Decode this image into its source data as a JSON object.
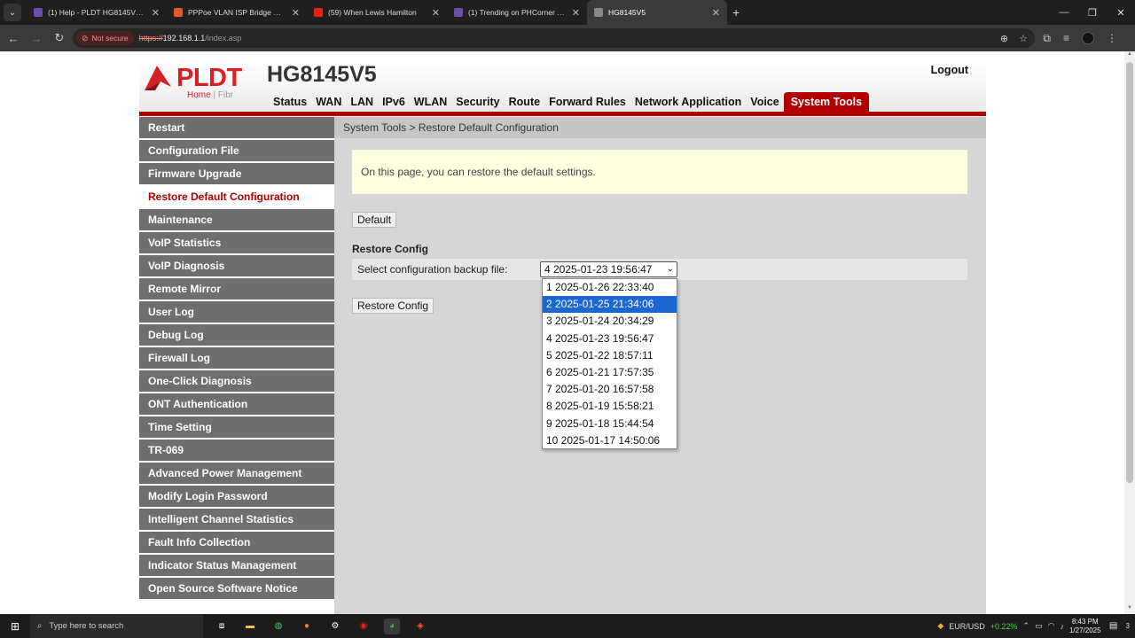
{
  "browser": {
    "tabs": [
      {
        "title": "(1) Help - PLDT HG8145V5 CGN",
        "color": "#6a4fa8",
        "active": false
      },
      {
        "title": "PPPoe VLAN ISP Bridge mode...",
        "color": "#e05a2b",
        "active": false
      },
      {
        "title": "(59) When Lewis Hamilton",
        "color": "#e62117",
        "active": false
      },
      {
        "title": "(1) Trending on PHCorner | Pin...",
        "color": "#6a4fa8",
        "active": false
      },
      {
        "title": "HG8145V5",
        "color": "#888888",
        "active": true
      }
    ],
    "security_chip": "Not secure",
    "url_scheme": "https://",
    "url_host": "192.168.1.1",
    "url_path": "/index.asp"
  },
  "router": {
    "logo": {
      "brand": "PLDT",
      "sub_home": "Home",
      "sub_fibr": "Fibr"
    },
    "model": "HG8145V5",
    "logout": "Logout",
    "nav": [
      "Status",
      "WAN",
      "LAN",
      "IPv6",
      "WLAN",
      "Security",
      "Route",
      "Forward Rules",
      "Network Application",
      "Voice",
      "System Tools"
    ],
    "nav_active": "System Tools",
    "sidebar": [
      "Restart",
      "Configuration File",
      "Firmware Upgrade",
      "Restore Default Configuration",
      "Maintenance",
      "VoIP Statistics",
      "VoIP Diagnosis",
      "Remote Mirror",
      "User Log",
      "Debug Log",
      "Firewall Log",
      "One-Click Diagnosis",
      "ONT Authentication",
      "Time Setting",
      "TR-069",
      "Advanced Power Management",
      "Modify Login Password",
      "Intelligent Channel Statistics",
      "Fault Info Collection",
      "Indicator Status Management",
      "Open Source Software Notice"
    ],
    "sidebar_active": "Restore Default Configuration",
    "breadcrumb": "System Tools > Restore Default Configuration",
    "notice": "On this page, you can restore the default settings.",
    "default_button": "Default",
    "section_title": "Restore Config",
    "select_label": "Select configuration backup file:",
    "select_value": "4 2025-01-23 19:56:47",
    "restore_button": "Restore Config",
    "options": [
      "1 2025-01-26 22:33:40",
      "2 2025-01-25 21:34:06",
      "3 2025-01-24 20:34:29",
      "4 2025-01-23 19:56:47",
      "5 2025-01-22 18:57:11",
      "6 2025-01-21 17:57:35",
      "7 2025-01-20 16:57:58",
      "8 2025-01-19 15:58:21",
      "9 2025-01-18 15:44:54",
      "10 2025-01-17 14:50:06"
    ],
    "option_highlighted": "2 2025-01-25 21:34:06",
    "accent_color": "#b00000"
  },
  "taskbar": {
    "search_placeholder": "Type here to search",
    "ticker_name": "EUR/USD",
    "ticker_change": "+0.22%",
    "time": "8:43 PM",
    "date": "1/27/2025",
    "notification_count": "3"
  }
}
